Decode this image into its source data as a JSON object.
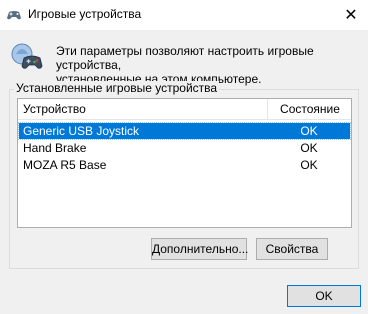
{
  "window": {
    "title": "Игровые устройства",
    "close_glyph": "✕",
    "icon": "gamepad-icon"
  },
  "header": {
    "icon": "game-controller-icon",
    "description": "Эти параметры позволяют настроить игровые устройства,\nустановленные на этом компьютере."
  },
  "group": {
    "label": "Установленные игровые устройства"
  },
  "list": {
    "columns": [
      "Устройство",
      "Состояние"
    ],
    "rows": [
      {
        "device": "Generic USB Joystick",
        "status": "OK",
        "selected": true
      },
      {
        "device": "Hand Brake",
        "status": "OK",
        "selected": false
      },
      {
        "device": "MOZA R5 Base",
        "status": "OK",
        "selected": false
      }
    ]
  },
  "buttons": {
    "advanced": "Дополнительно...",
    "properties": "Свойства",
    "ok": "OK"
  },
  "colors": {
    "selection": "#0078d7",
    "background": "#f0f0f0"
  }
}
